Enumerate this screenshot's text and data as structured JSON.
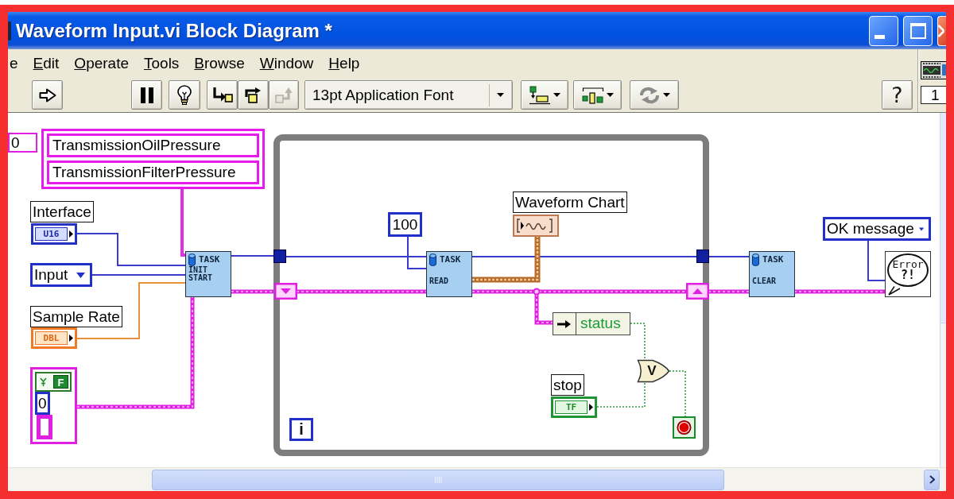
{
  "window": {
    "title": "Waveform Input.vi Block Diagram *",
    "buttons": [
      {
        "kind": "minimize"
      },
      {
        "kind": "maximize"
      },
      {
        "kind": "close"
      }
    ]
  },
  "menu_bar": [
    {
      "label": "e",
      "underlined": false
    },
    {
      "label": "Edit",
      "underlined": true
    },
    {
      "label": "Operate",
      "underlined": true
    },
    {
      "label": "Tools",
      "underlined": true
    },
    {
      "label": "Browse",
      "underlined": true
    },
    {
      "label": "Window",
      "underlined": true
    },
    {
      "label": "Help",
      "underlined": true
    }
  ],
  "toolbar": {
    "run_buttons": [
      {
        "kind": "run",
        "disabled": false
      },
      {
        "kind": "pause",
        "disabled": false
      },
      {
        "kind": "highlight",
        "disabled": false
      },
      {
        "kind": "step_into",
        "disabled": false
      },
      {
        "kind": "step_over",
        "disabled": false
      },
      {
        "kind": "step_out",
        "disabled": true
      }
    ],
    "font": {
      "value": "13pt Application Font"
    },
    "arrange_buttons": [
      {
        "kind": "align"
      },
      {
        "kind": "distribute"
      },
      {
        "kind": "reorder"
      }
    ],
    "help": {
      "label": "?"
    }
  },
  "icon_pane": {
    "label": "1"
  },
  "diagram": {
    "array_index": "0",
    "string_array": [
      "TransmissionOilPressure",
      "TransmissionFilterPressure"
    ],
    "interface": {
      "label": "Interface",
      "type": "U16",
      "kind": "integer"
    },
    "input_ring": {
      "value": "Input"
    },
    "sample_rate": {
      "label": "Sample Rate",
      "type": "DBL",
      "kind": "float"
    },
    "cluster_constant": {
      "boolean": "F",
      "number": "0"
    },
    "init_node": {
      "title": "TASK",
      "lines": [
        "INIT",
        "START"
      ]
    },
    "while_loop": {
      "count_constant": "100",
      "read_node": {
        "title": "TASK",
        "lines": [
          "READ"
        ]
      },
      "chart": {
        "label": "Waveform Chart"
      },
      "unbundle": {
        "field": "status"
      },
      "or_gate": {
        "symbol": "V"
      },
      "stop": {
        "label": "stop",
        "type": "TF",
        "kind": "boolean"
      },
      "iteration": "i"
    },
    "clear_node": {
      "title": "TASK",
      "lines": [
        "CLEAR"
      ]
    },
    "message_ring": {
      "value": "OK message"
    },
    "error_handler": {
      "lines": [
        "Error",
        "?!"
      ]
    }
  }
}
